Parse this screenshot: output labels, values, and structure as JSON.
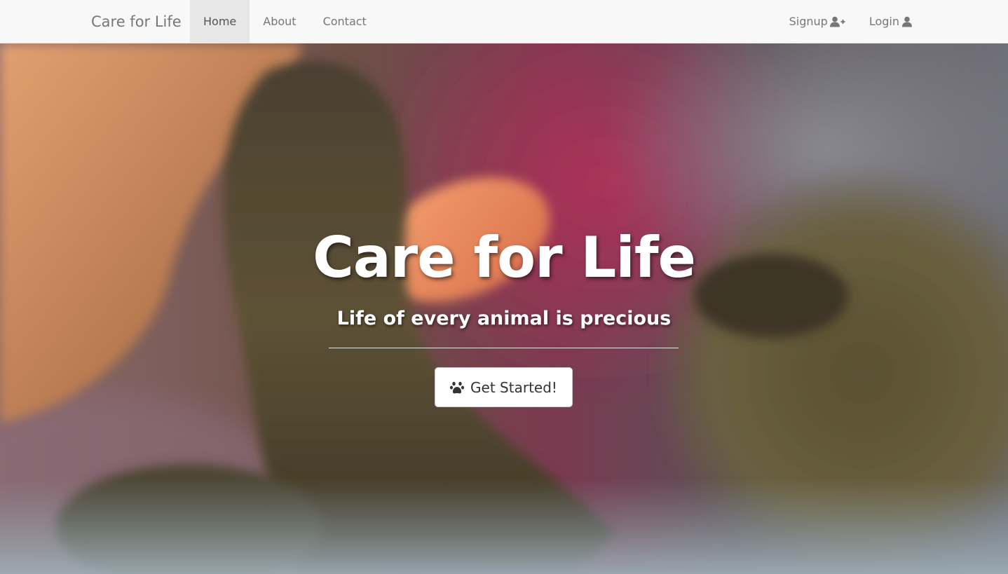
{
  "navbar": {
    "brand": "Care for Life",
    "left_items": [
      {
        "label": "Home",
        "active": true
      },
      {
        "label": "About",
        "active": false
      },
      {
        "label": "Contact",
        "active": false
      }
    ],
    "right_items": [
      {
        "label": "Signup",
        "icon": "user-plus-icon"
      },
      {
        "label": "Login",
        "icon": "user-icon"
      }
    ]
  },
  "hero": {
    "title": "Care for Life",
    "subtitle": "Life of every animal is precious",
    "cta_label": "Get Started!",
    "cta_icon": "paw-icon",
    "background_image": "photo of a person's hand touching a cat's paw"
  },
  "colors": {
    "navbar_bg": "#f8f8f8",
    "nav_active_bg": "#e7e7e7",
    "nav_text": "#777777",
    "hero_text": "#ffffff",
    "button_bg": "#ffffff",
    "button_text": "#333333"
  }
}
